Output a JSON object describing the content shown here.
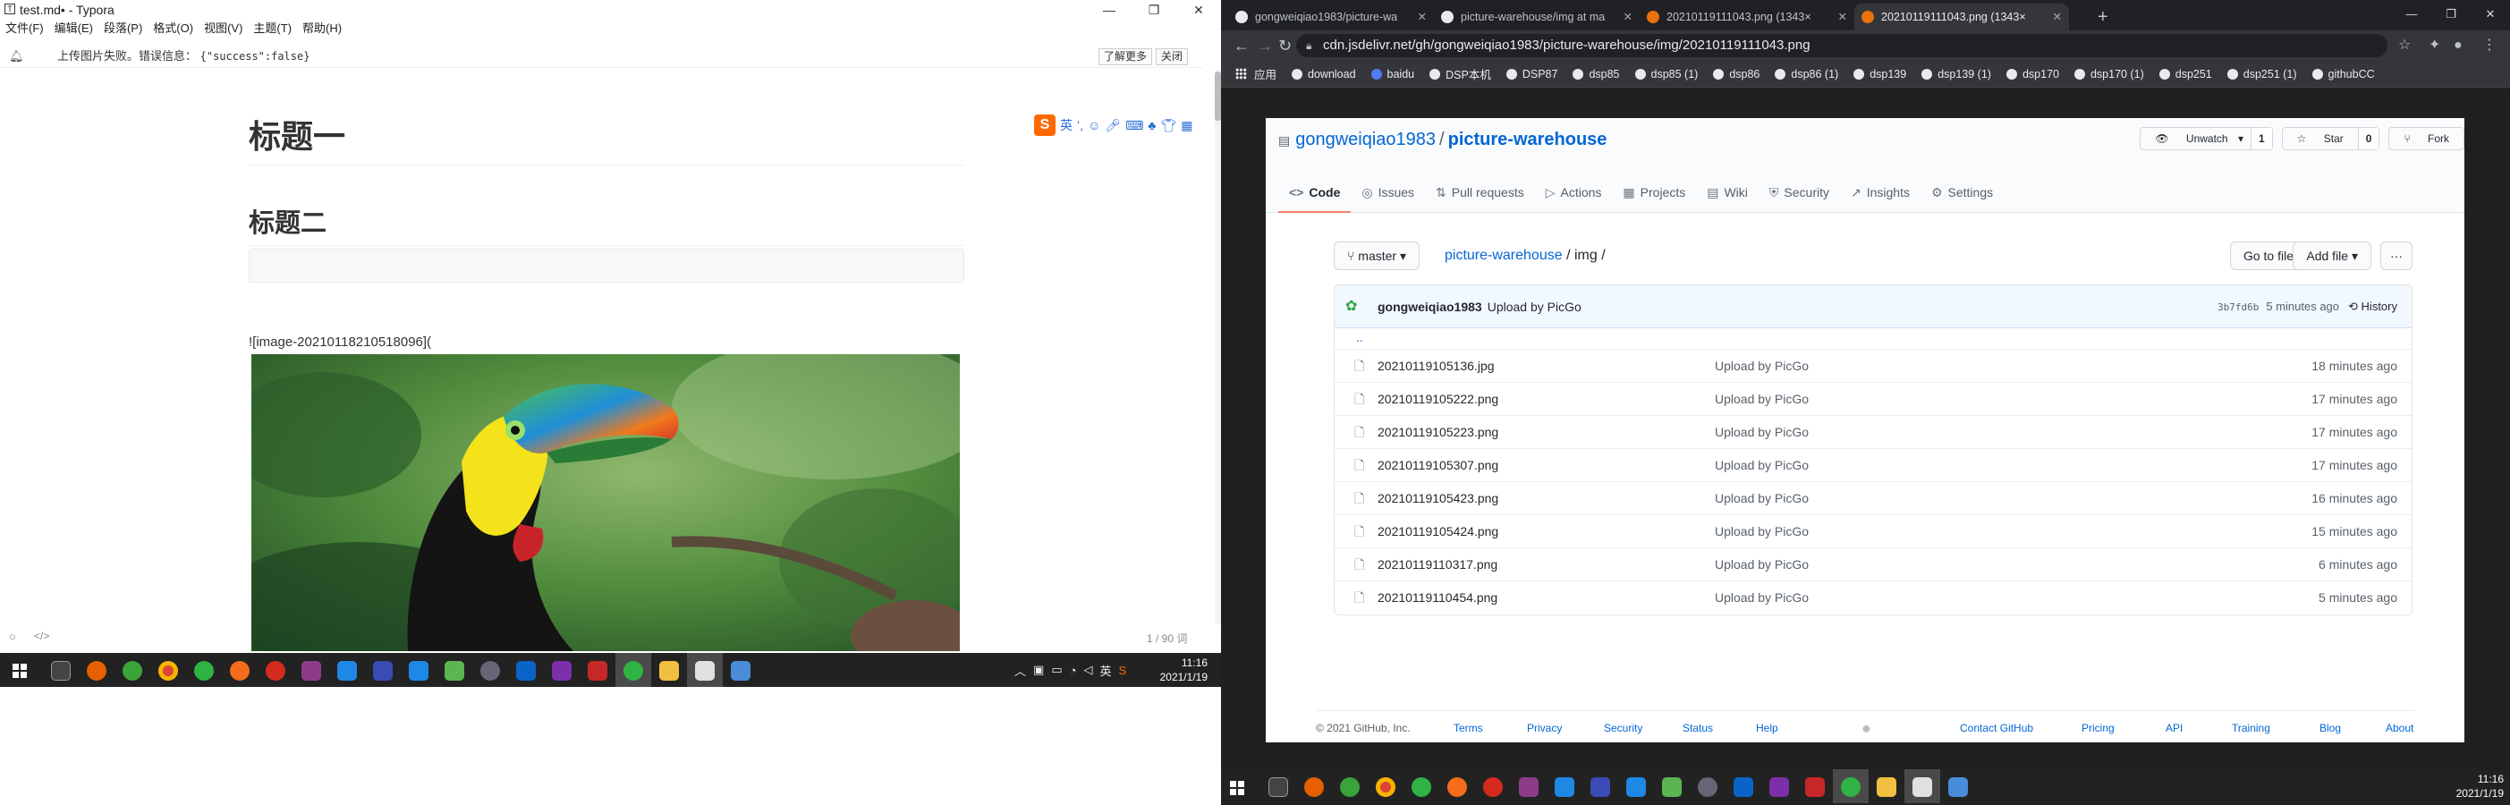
{
  "typora": {
    "title": "test.md• - Typora",
    "menu": [
      "文件(F)",
      "编辑(E)",
      "段落(P)",
      "格式(O)",
      "视图(V)",
      "主题(T)",
      "帮助(H)"
    ],
    "notice_text": "上传图片失败。错误信息：",
    "notice_code": "{\"success\":false}",
    "notice_more": "了解更多",
    "notice_close": "关闭",
    "ime_label": "英",
    "h1": "标题一",
    "h2": "标题二",
    "image_markdown": "![image-20210118210518096](",
    "word_count": "1 / 90 词"
  },
  "taskbar_left": {
    "time": "11:16",
    "date": "2021/1/19",
    "lang": "英"
  },
  "taskbar_right": {
    "time": "11:16",
    "date": "2021/1/19"
  },
  "chrome": {
    "tabs": [
      {
        "title": "gongweiqiao1983/picture-wa",
        "favicon_color": "#e8eaed"
      },
      {
        "title": "picture-warehouse/img at ma",
        "favicon_color": "#e8eaed"
      },
      {
        "title": "20210119111043.png (1343×",
        "favicon_color": "#e8710a"
      },
      {
        "title": "20210119111043.png (1343×",
        "favicon_color": "#e8710a"
      }
    ],
    "url": "cdn.jsdelivr.net/gh/gongweiqiao1983/picture-warehouse/img/20210119111043.png",
    "bookmarks": [
      "应用",
      "download",
      "baidu",
      "DSP本机",
      "DSP87",
      "dsp85",
      "dsp85 (1)",
      "dsp86",
      "dsp86 (1)",
      "dsp139",
      "dsp139 (1)",
      "dsp170",
      "dsp170 (1)",
      "dsp251",
      "dsp251 (1)",
      "githubCC"
    ]
  },
  "github": {
    "owner": "gongweiqiao1983",
    "repo": "picture-warehouse",
    "unwatch_label": "Unwatch",
    "watch_count": "1",
    "star_label": "Star",
    "star_count": "0",
    "fork_label": "Fork",
    "tabs": [
      {
        "label": "Code",
        "icon": "<>"
      },
      {
        "label": "Issues",
        "icon": "◎"
      },
      {
        "label": "Pull requests",
        "icon": "⇅"
      },
      {
        "label": "Actions",
        "icon": "▷"
      },
      {
        "label": "Projects",
        "icon": "▦"
      },
      {
        "label": "Wiki",
        "icon": "▤"
      },
      {
        "label": "Security",
        "icon": "⛨"
      },
      {
        "label": "Insights",
        "icon": "↗"
      },
      {
        "label": "Settings",
        "icon": "⚙"
      }
    ],
    "branch": "master",
    "breadcrumb_repo": "picture-warehouse",
    "breadcrumb_path": "img /",
    "go_to_file": "Go to file",
    "add_file": "Add file",
    "more": "···",
    "commit": {
      "author": "gongweiqiao1983",
      "message": "Upload by PicGo",
      "sha": "3b7fd6b",
      "age": "5 minutes ago",
      "history": "History"
    },
    "parent_dir": "..",
    "files": [
      {
        "name": "20210119105136.jpg",
        "message": "Upload by PicGo",
        "age": "18 minutes ago"
      },
      {
        "name": "20210119105222.png",
        "message": "Upload by PicGo",
        "age": "17 minutes ago"
      },
      {
        "name": "20210119105223.png",
        "message": "Upload by PicGo",
        "age": "17 minutes ago"
      },
      {
        "name": "20210119105307.png",
        "message": "Upload by PicGo",
        "age": "17 minutes ago"
      },
      {
        "name": "20210119105423.png",
        "message": "Upload by PicGo",
        "age": "16 minutes ago"
      },
      {
        "name": "20210119105424.png",
        "message": "Upload by PicGo",
        "age": "15 minutes ago"
      },
      {
        "name": "20210119110317.png",
        "message": "Upload by PicGo",
        "age": "6 minutes ago"
      },
      {
        "name": "20210119110454.png",
        "message": "Upload by PicGo",
        "age": "5 minutes ago"
      }
    ],
    "footer": {
      "copyright": "© 2021 GitHub, Inc.",
      "left_links": [
        "Terms",
        "Privacy",
        "Security",
        "Status",
        "Help"
      ],
      "right_links": [
        "Contact GitHub",
        "Pricing",
        "API",
        "Training",
        "Blog",
        "About"
      ]
    }
  }
}
